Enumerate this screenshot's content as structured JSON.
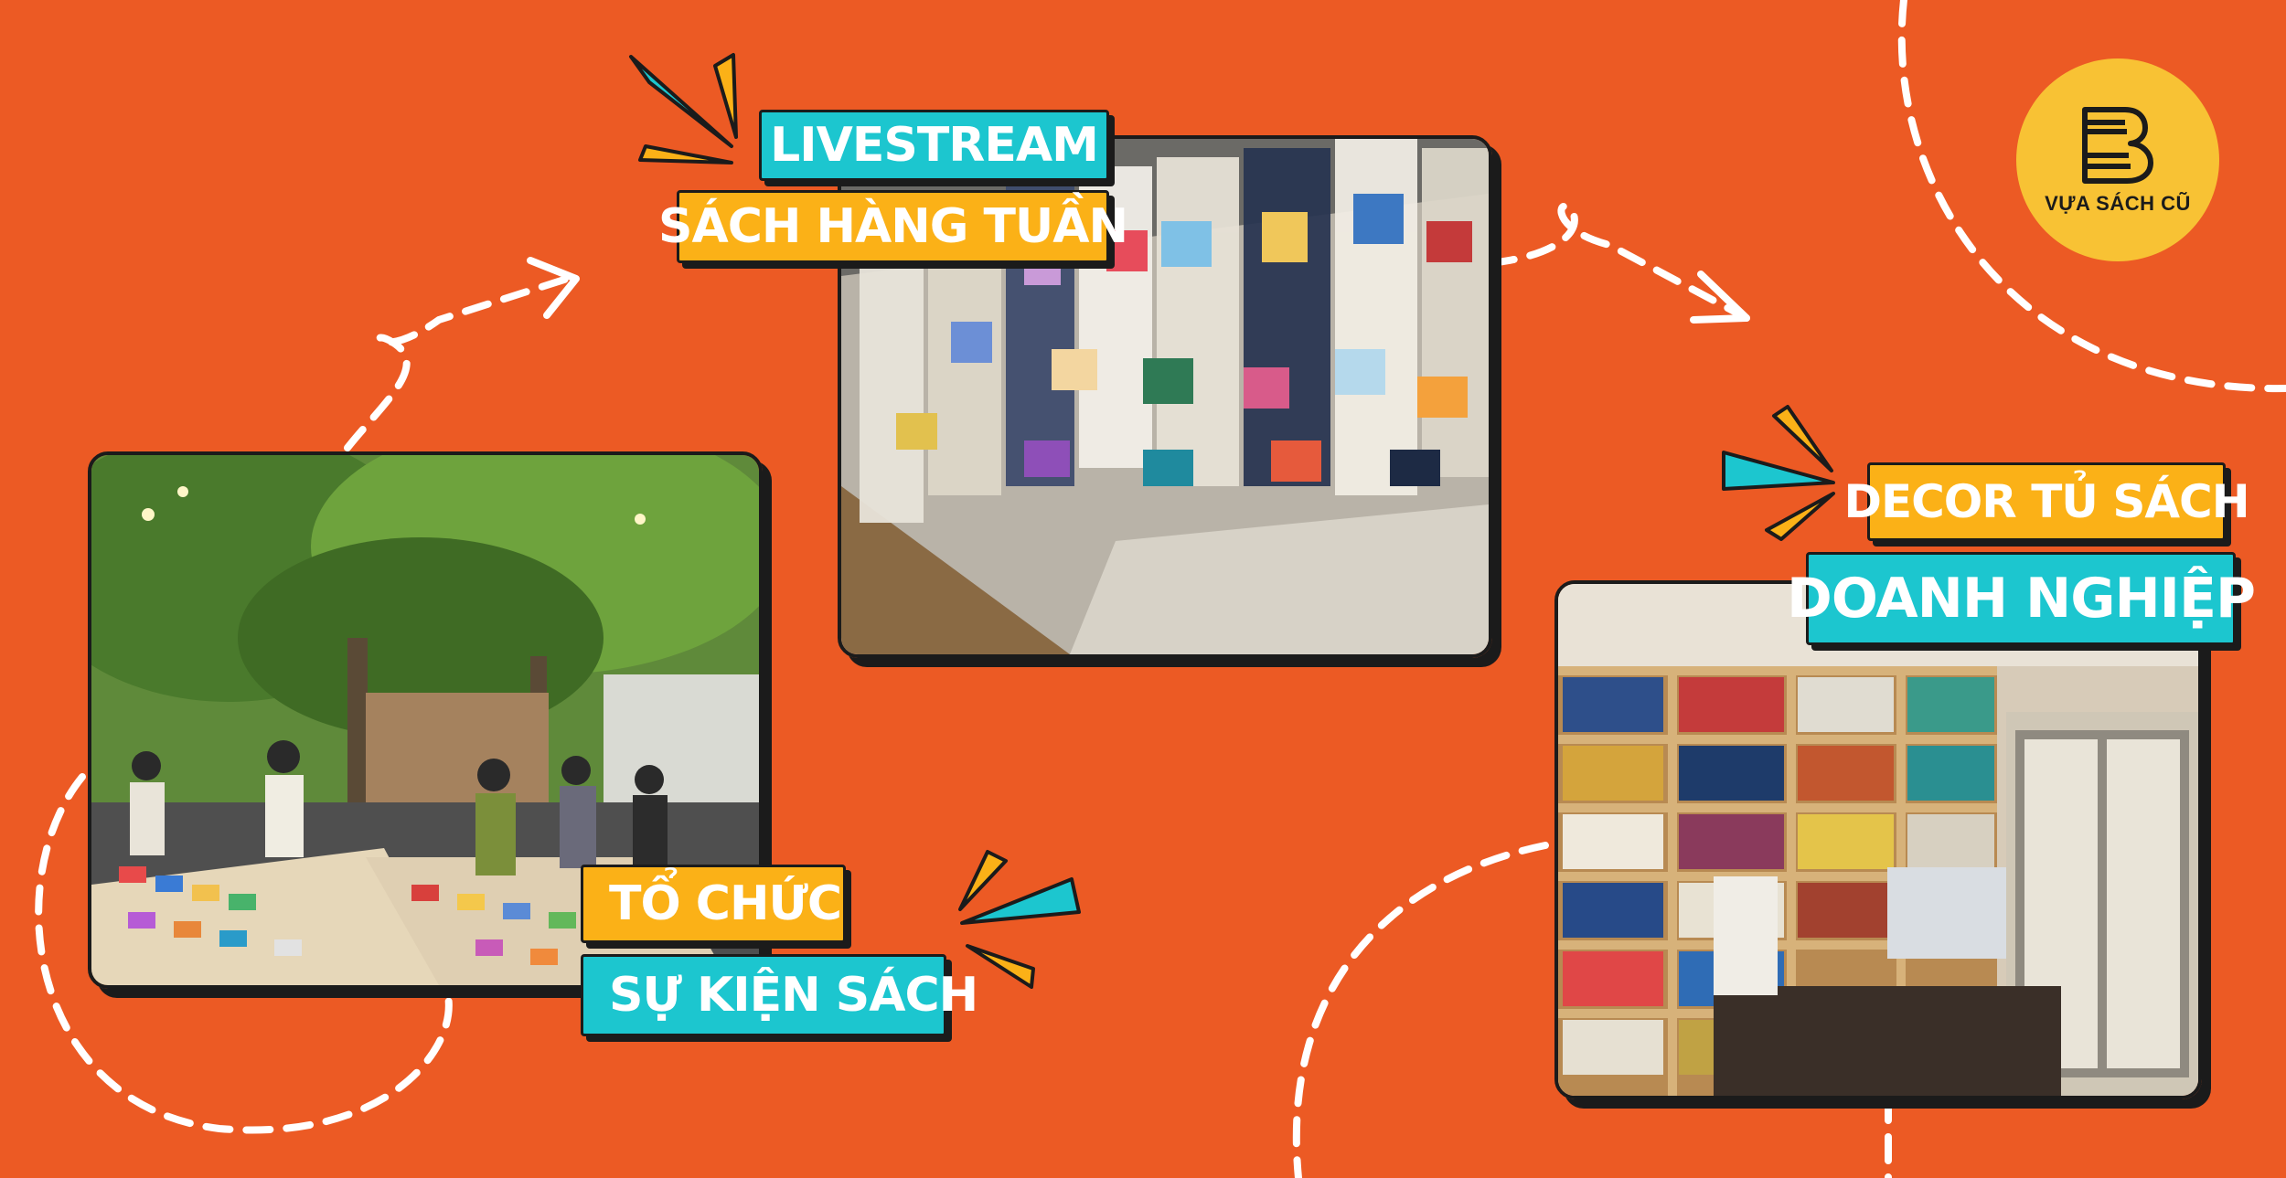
{
  "brand": {
    "name": "VỰA SÁCH CŨ",
    "background_color": "#EC5A24",
    "teal": "#1CC6CF",
    "amber": "#FBB117",
    "logo_color": "#F8C234",
    "logo_icon": "book-b-logo-icon"
  },
  "services": [
    {
      "line1": "LIVESTREAM",
      "line2": "SÁCH HÀNG TUẦN",
      "photo": "book-stacks-warehouse-photo"
    },
    {
      "line1": "TỔ CHỨC",
      "line2": "SỰ KIỆN SÁCH",
      "photo": "outdoor-book-fair-photo"
    },
    {
      "line1": "DECOR TỦ SÁCH",
      "line2": "DOANH NGHIỆP",
      "photo": "office-bookshelf-photo"
    }
  ]
}
